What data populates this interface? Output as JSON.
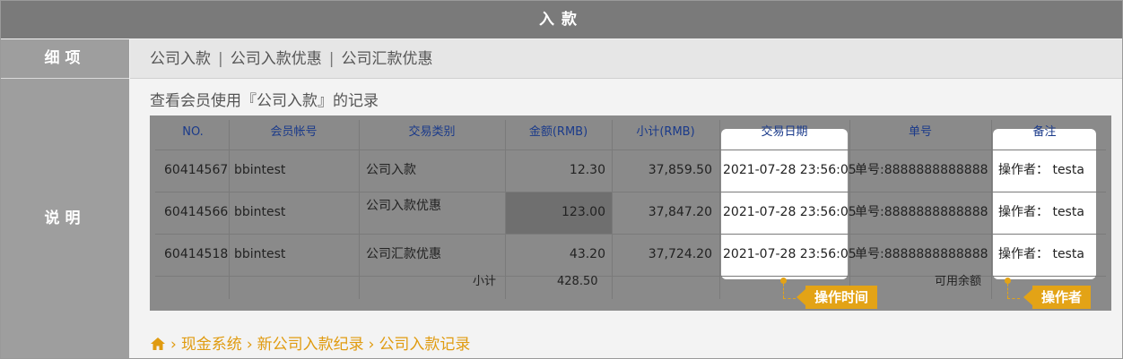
{
  "header": {
    "title": "入款"
  },
  "left": {
    "detail_label": "细项",
    "desc_label": "说明"
  },
  "tabs": [
    "公司入款",
    "公司入款优惠",
    "公司汇款优惠"
  ],
  "description": "查看会员使用『公司入款』的记录",
  "table": {
    "columns": [
      "NO.",
      "会员帐号",
      "交易类别",
      "金额(RMB)",
      "小计(RMB)",
      "交易日期",
      "单号",
      "备注"
    ],
    "rows": [
      [
        "60414567",
        "bbintest",
        "公司入款",
        "12.30",
        "37,859.50",
        "2021-07-28 23:56:05",
        "单号:8888888888888",
        "操作者： testa"
      ],
      [
        "60414566",
        "bbintest",
        "公司入款优惠",
        "123.00",
        "37,847.20",
        "2021-07-28 23:56:05",
        "单号:8888888888888",
        "操作者： testa"
      ],
      [
        "60414518",
        "bbintest",
        "公司汇款优惠",
        "43.20",
        "37,724.20",
        "2021-07-28 23:56:05",
        "单号:8888888888888",
        "操作者： testa"
      ]
    ],
    "subtotal_label": "小计",
    "subtotal_value": "428.50",
    "available_label": "可用余额"
  },
  "callouts": {
    "time": "操作时间",
    "operator": "操作者"
  },
  "breadcrumb": [
    "现金系统",
    "新公司入款纪录",
    "公司入款记录"
  ],
  "colors": {
    "accent": "#e3a316",
    "header_blue": "#1a3a8a"
  },
  "icons": {
    "home": "home-icon",
    "separator": "chevron-right-icon"
  }
}
